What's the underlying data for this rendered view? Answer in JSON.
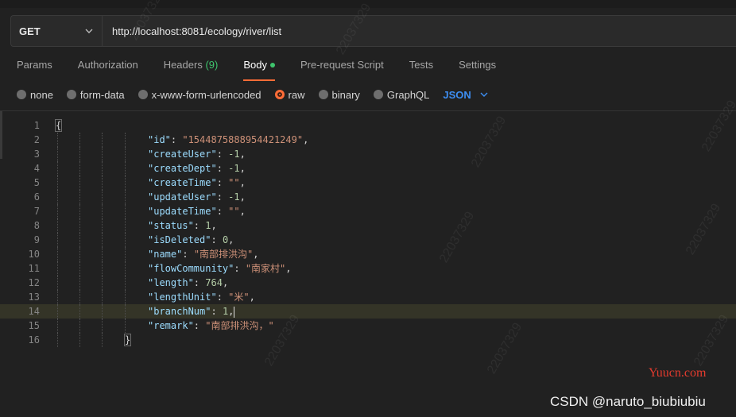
{
  "request": {
    "method": "GET",
    "url": "http://localhost:8081/ecology/river/list"
  },
  "tabs": [
    {
      "label": "Params"
    },
    {
      "label": "Authorization"
    },
    {
      "label": "Headers",
      "count": "(9)"
    },
    {
      "label": "Body"
    },
    {
      "label": "Pre-request Script"
    },
    {
      "label": "Tests"
    },
    {
      "label": "Settings"
    }
  ],
  "body_options": [
    "none",
    "form-data",
    "x-www-form-urlencoded",
    "raw",
    "binary",
    "GraphQL"
  ],
  "format": "JSON",
  "editor": {
    "line_numbers": [
      "1",
      "2",
      "3",
      "4",
      "5",
      "6",
      "7",
      "8",
      "9",
      "10",
      "11",
      "12",
      "13",
      "14",
      "15",
      "16"
    ],
    "open_brace": "{",
    "close_brace": "}",
    "lines": [
      {
        "key": "\"id\"",
        "sep": ": ",
        "value": "\"1544875888954421249\"",
        "type": "str",
        "tail": ","
      },
      {
        "key": "\"createUser\"",
        "sep": ": ",
        "value": "-1",
        "type": "num",
        "tail": ","
      },
      {
        "key": "\"createDept\"",
        "sep": ": ",
        "value": "-1",
        "type": "num",
        "tail": ","
      },
      {
        "key": "\"createTime\"",
        "sep": ": ",
        "value": "\"\"",
        "type": "str",
        "tail": ","
      },
      {
        "key": "\"updateUser\"",
        "sep": ": ",
        "value": "-1",
        "type": "num",
        "tail": ","
      },
      {
        "key": "\"updateTime\"",
        "sep": ": ",
        "value": "\"\"",
        "type": "str",
        "tail": ","
      },
      {
        "key": "\"status\"",
        "sep": ": ",
        "value": "1",
        "type": "num",
        "tail": ","
      },
      {
        "key": "\"isDeleted\"",
        "sep": ": ",
        "value": "0",
        "type": "num",
        "tail": ","
      },
      {
        "key": "\"name\"",
        "sep": ": ",
        "value": "\"南部排洪沟\"",
        "type": "str",
        "tail": ","
      },
      {
        "key": "\"flowCommunity\"",
        "sep": ": ",
        "value": "\"南家村\"",
        "type": "str",
        "tail": ","
      },
      {
        "key": "\"length\"",
        "sep": ": ",
        "value": "764",
        "type": "num",
        "tail": ","
      },
      {
        "key": "\"lengthUnit\"",
        "sep": ": ",
        "value": "\"米\"",
        "type": "str",
        "tail": ","
      },
      {
        "key": "\"branchNum\"",
        "sep": ": ",
        "value": "1",
        "type": "num",
        "tail": ","
      },
      {
        "key": "\"remark\"",
        "sep": ": ",
        "value": "\"南部排洪沟，\"",
        "type": "str",
        "tail": ""
      }
    ]
  },
  "watermark": "22037329",
  "site_mark": "Yuucn.com",
  "credit": "CSDN @naruto_biubiubiu"
}
